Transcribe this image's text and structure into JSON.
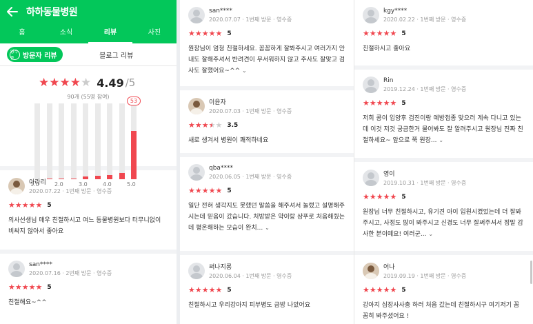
{
  "header": {
    "title": "하하동물병원"
  },
  "tabs": [
    "홈",
    "소식",
    "리뷰",
    "사진"
  ],
  "active_tab": "리뷰",
  "subtabs": {
    "visitor_badge": "영수증",
    "visitor_label": "방문자 리뷰",
    "blog_label": "블로그 리뷰"
  },
  "summary": {
    "score": "4.49",
    "max": "/5",
    "count_text": "90개 (55명 참여)",
    "highlight_count": "53"
  },
  "chart_data": {
    "type": "bar",
    "title": "",
    "categories": [
      "1.0",
      "1.5",
      "2.0",
      "2.5",
      "3.0",
      "3.5",
      "4.0",
      "4.5",
      "5.0"
    ],
    "values": [
      0,
      1,
      1,
      1,
      3,
      4,
      5,
      7,
      53
    ],
    "tick_labels": [
      "1.0",
      "2.0",
      "3.0",
      "4.0",
      "5.0"
    ],
    "ylim": [
      0,
      100
    ],
    "grid": false,
    "color": "#f0474f"
  },
  "reviews_col1": [
    {
      "nick": "아라리",
      "info": "2020.07.22 · 1번째 방문 · 영수증",
      "score": "5",
      "rating": 5,
      "text": "의사선생님 매우 친절하시고 여느 동물병원보다 터무니없이 비싸지 않아서 좋아요",
      "more": ""
    },
    {
      "nick": "san****",
      "info": "2020.07.16 · 2번째 방문 · 영수증",
      "score": "5",
      "rating": 5,
      "text": "친절해요~^^",
      "more": ""
    }
  ],
  "reviews_col2": [
    {
      "nick": "san****",
      "info": "2020.07.07 · 1번째 방문 · 영수증",
      "score": "5",
      "rating": 5,
      "text": "원장님이 엄청 친절하세요. 꼼꼼하게 잘봐주시고 여러가지 안내도 잘해주셔서 반려견이 무서워하지 않고 주사도 잘맞고 검사도 잘했어요~^^",
      "more": "⌄"
    },
    {
      "nick": "이윤자",
      "info": "2020.07.03 · 1번째 방문 · 영수증",
      "score": "3.5",
      "rating": 3.5,
      "text": "새로 생겨서 병원이 쾌적하네요",
      "more": ""
    },
    {
      "nick": "qba****",
      "info": "2020.06.05 · 1번째 방문 · 영수증",
      "score": "5",
      "rating": 5,
      "text": "일단 전혀 생각지도 못했던 말씀을 해주셔서 놀랬고 설명해주시는데 믿음이 갔습니다. 처방받은 약이랑 샴푸로 처음해줬는데 평온해하는 모습이 완치...",
      "more": "⌄"
    },
    {
      "nick": "써나지롱",
      "info": "2020.06.04 · 1번째 방문 · 영수증",
      "score": "5",
      "rating": 5,
      "text": "친절하시고 우리강아지 피부병도 금방 나았어요",
      "more": ""
    }
  ],
  "reviews_col3": [
    {
      "nick": "kgy****",
      "info": "2020.02.22 · 1번째 방문 · 영수증",
      "score": "5",
      "rating": 5,
      "text": "친절하시고 좋아요",
      "more": ""
    },
    {
      "nick": "Rin",
      "info": "2019.12.24 · 1번째 방문 · 영수증",
      "score": "5",
      "rating": 5,
      "text": "저희 콩이 입양후 검진이랑 예방접종 맞으러 계속 다니고 있는데 이것 저것 궁금한거 물어봐도 잘 알려주시고 원장님 진짜 친절하세요~ 앞으로 쭉 원장...",
      "more": "⌄"
    },
    {
      "nick": "영이",
      "info": "2019.10.31 · 1번째 방문 · 영수증",
      "score": "5",
      "rating": 5,
      "text": "원장님 너무 친절하시고, 유기견 아이 입원시켰었는데 더 잘봐주시고, 사정도 많이 봐주시고 신경도 너무 잘써주셔서 정말 감사한 분이예요! 여러군...",
      "more": "⌄"
    },
    {
      "nick": "어나",
      "info": "2019.09.19 · 1번째 방문 · 영수증",
      "score": "5",
      "rating": 5,
      "text": "강아지 심장사사충 하러 처음 갔는데 친절하시구 여기저기 꼼꼼히 봐주셨어요 !",
      "more": ""
    }
  ]
}
